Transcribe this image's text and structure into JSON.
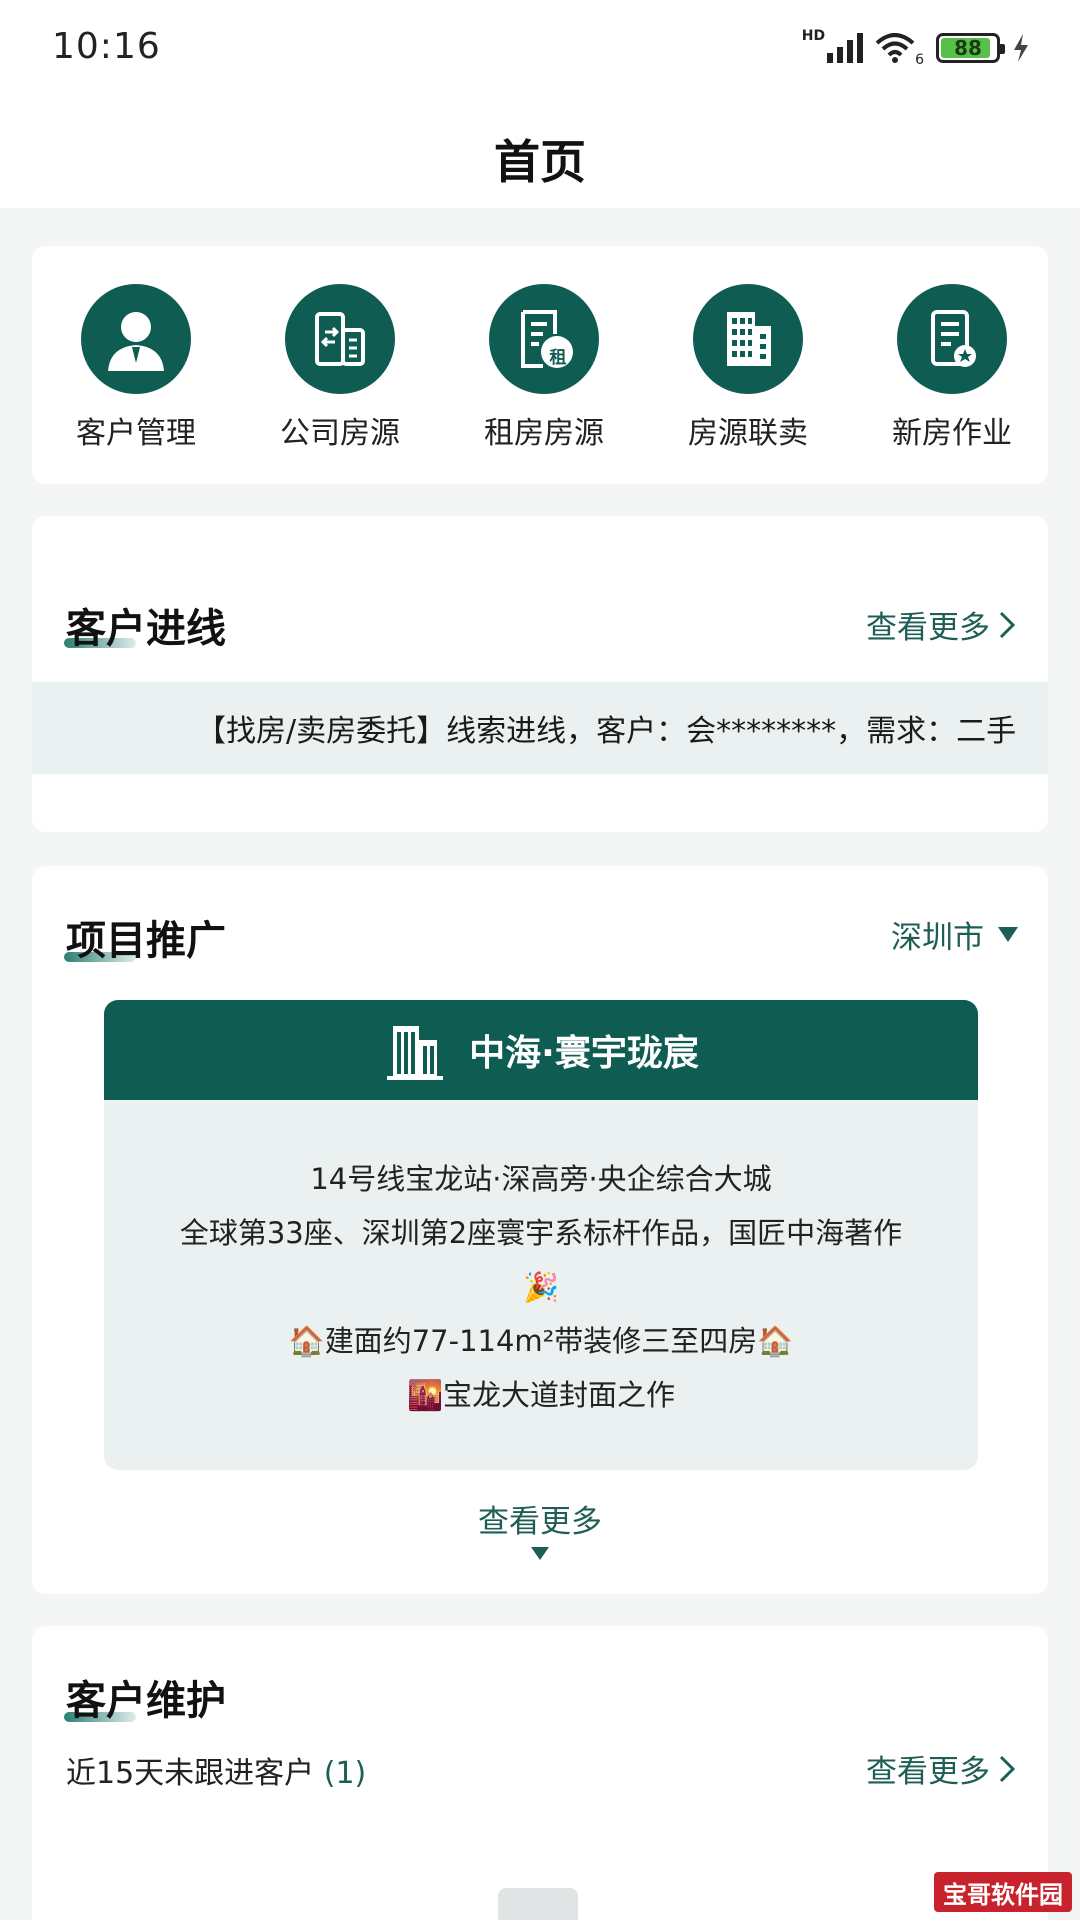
{
  "status_bar": {
    "time": "10:16",
    "network_label": "HD",
    "wifi_label": "6",
    "battery_level": "88"
  },
  "header": {
    "title": "首页"
  },
  "quick_actions": [
    {
      "label": "客户管理",
      "icon": "customer-icon"
    },
    {
      "label": "公司房源",
      "icon": "company-listing-icon"
    },
    {
      "label": "租房房源",
      "icon": "rental-listing-icon",
      "badge": "租"
    },
    {
      "label": "房源联卖",
      "icon": "building-icon"
    },
    {
      "label": "新房作业",
      "icon": "new-house-doc-icon"
    }
  ],
  "leads": {
    "title": "客户进线",
    "more": "查看更多",
    "ticker": "【找房/卖房委托】线索进线，客户：会********，需求：二手"
  },
  "project": {
    "title": "项目推广",
    "city": "深圳市",
    "name": "中海·寰宇珑宸",
    "lines": [
      "14号线宝龙站·深高旁·央企综合大城",
      "全球第33座、深圳第2座寰宇系标杆作品，国匠中海著作",
      "🎉",
      "🏠建面约77-114m²带装修三至四房🏠",
      "🌇宝龙大道封面之作"
    ],
    "more": "查看更多"
  },
  "maintenance": {
    "title": "客户维护",
    "subtitle": "近15天未跟进客户",
    "count": "(1)",
    "more": "查看更多"
  },
  "watermark": "宝哥软件园",
  "colors": {
    "primary": "#0f5c53",
    "link": "#1f5e56",
    "tint": "#ebf1f0"
  }
}
